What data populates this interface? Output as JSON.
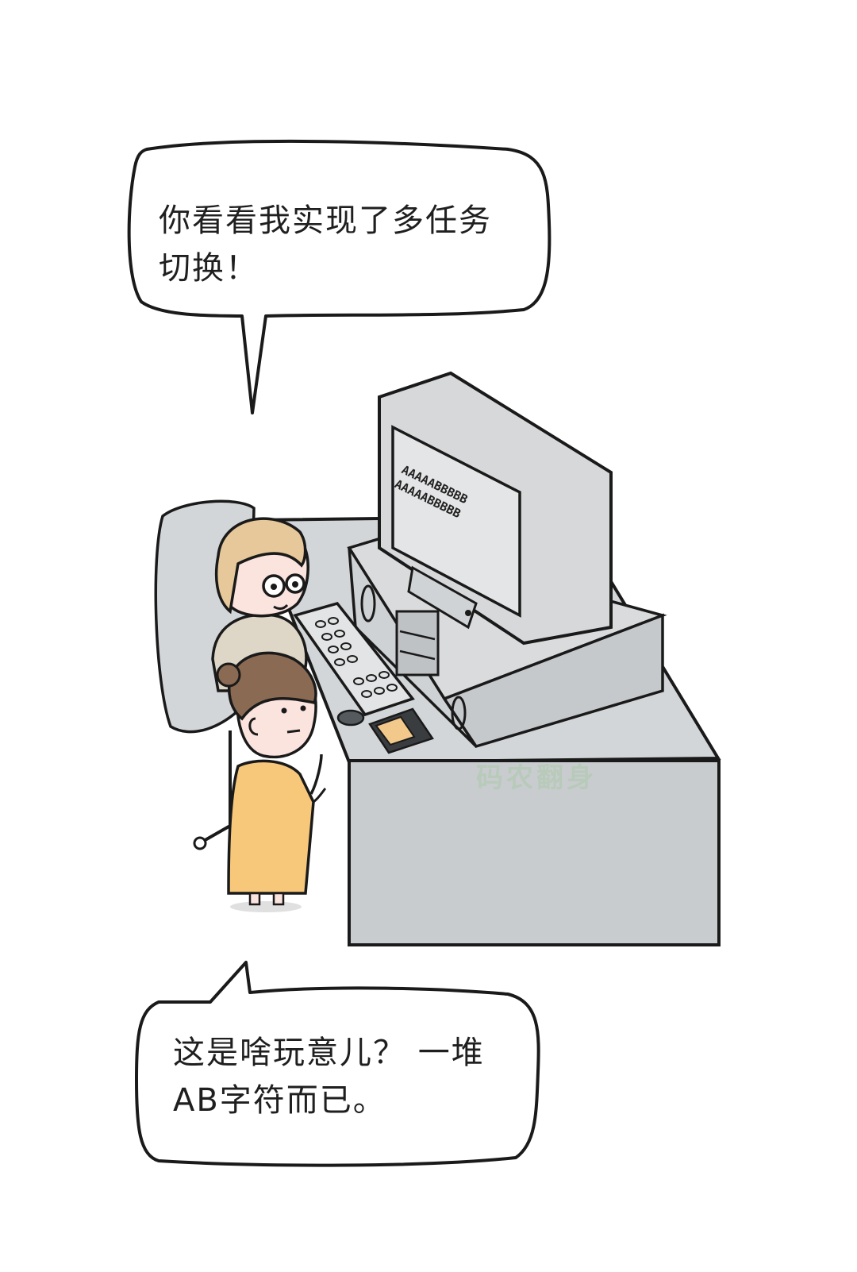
{
  "bubble_top": {
    "line1": "你看看我实现了多任务",
    "line2": "切换！"
  },
  "bubble_bottom": {
    "line1": "这是啥玩意儿？ 一堆",
    "line2": "AB字符而已。"
  },
  "monitor_screen": {
    "row1": "AAAAABBBBB",
    "row2": "AAAAABBBBB"
  },
  "watermark": "码农翻身",
  "colors": {
    "furniture": "#d3d6d8",
    "desk_front": "#c9cccf",
    "hair_man": "#e6c89a",
    "hair_girl": "#8a6a52",
    "dress": "#f7c77a",
    "skin": "#fbe3de",
    "outline": "#1a1a1a"
  }
}
